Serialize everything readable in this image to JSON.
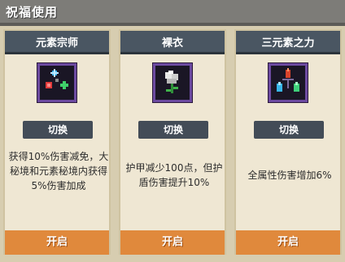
{
  "header": {
    "title": "祝福使用"
  },
  "cards": [
    {
      "title": "元素宗师",
      "icon": "element-master-icon",
      "switch_label": "切换",
      "description": "获得10%伤害减免，大秘境和元素秘境内获得5%伤害加成",
      "start_label": "开启"
    },
    {
      "title": "裸衣",
      "icon": "naked-flower-icon",
      "switch_label": "切换",
      "description": "护甲减少100点，但护盾伤害提升10%",
      "start_label": "开启"
    },
    {
      "title": "三元素之力",
      "icon": "three-elements-icon",
      "switch_label": "切换",
      "description": "全属性伤害增加6%",
      "start_label": "开启"
    }
  ]
}
